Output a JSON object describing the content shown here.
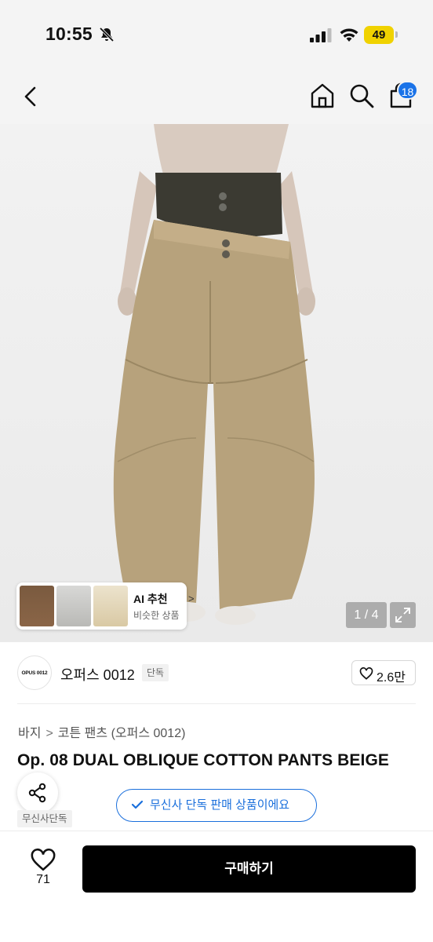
{
  "status_bar": {
    "time": "10:55",
    "battery": "49",
    "icons": [
      "bell-off-icon",
      "signal-icon",
      "wifi-icon",
      "battery-icon"
    ]
  },
  "header": {
    "icons": [
      "back-icon",
      "home-icon",
      "search-icon",
      "bag-icon"
    ],
    "cart_count": "18"
  },
  "gallery": {
    "image_subject": "beige wide-leg cotton pants with dark layered waistband",
    "page_indicator": "1 / 4",
    "ai_recommend": {
      "title": "AI 추천",
      "subtitle": "비슷한 상품"
    }
  },
  "brand": {
    "logo_text": "OPUS 0012",
    "name": "오퍼스 0012",
    "tag": "단독",
    "likes": "2.6만"
  },
  "product": {
    "breadcrumb": [
      "바지",
      "코튼 팬츠 (오퍼스 0012)"
    ],
    "title": "Op. 08 DUAL OBLIQUE COTTON PANTS BEIGE",
    "exclusive_tag": "무신사단독",
    "exclusive_banner": "무신사 단독 판매 상품이에요"
  },
  "bottom_bar": {
    "wish_count": "71",
    "buy_label": "구매하기"
  },
  "colors": {
    "accent_blue": "#1a6fdc",
    "badge_blue": "#1a73e8",
    "buy_button": "#000000",
    "battery": "#f0d200"
  }
}
